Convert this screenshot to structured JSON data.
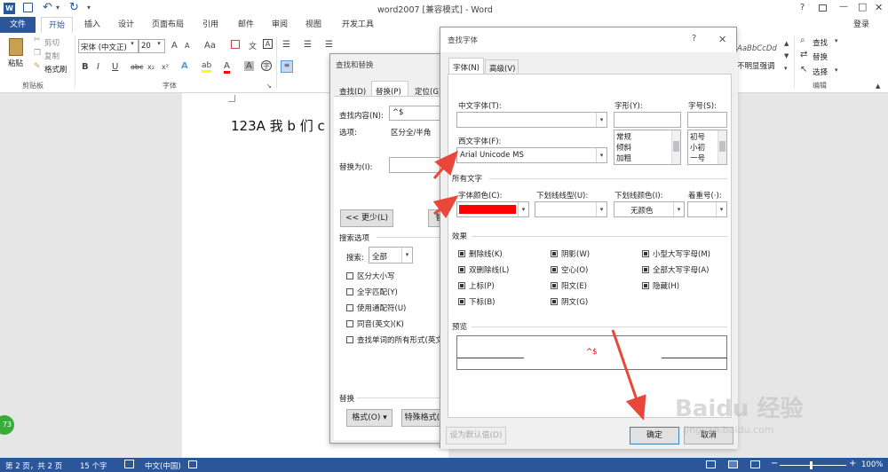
{
  "window": {
    "title": "word2007 [兼容模式] - Word",
    "help": "?",
    "minimize": "—",
    "restore": "□",
    "close": "✕",
    "login": "登录"
  },
  "qat": {
    "word": "W",
    "save": "💾",
    "undo": "↶",
    "redo": "↻",
    "more": "▾"
  },
  "tabs": [
    "文件",
    "开始",
    "插入",
    "设计",
    "页面布局",
    "引用",
    "邮件",
    "审阅",
    "视图",
    "开发工具"
  ],
  "ribbon": {
    "clipboard": {
      "paste": "粘贴",
      "cut": "剪切",
      "copy": "复制",
      "painter": "格式刷",
      "label": "剪贴板"
    },
    "font": {
      "name": "宋体 (中文正)",
      "size": "20",
      "label": "字体",
      "b": "B",
      "i": "I",
      "u": "U",
      "strike": "abc",
      "sub": "x₂",
      "sup": "x²",
      "grow": "A",
      "shrink": "A",
      "aa": "Aa",
      "a_color": "A"
    },
    "styles": {
      "sample": "AaBbCcDd",
      "name": "不明显强调"
    },
    "editing": {
      "find": "查找",
      "replace": "替换",
      "select": "选择",
      "label": "编辑"
    }
  },
  "doc": {
    "text": "123A 我 b 们 c"
  },
  "find_replace": {
    "title": "查找和替换",
    "tabs": [
      "查找(D)",
      "替换(P)",
      "定位(G)"
    ],
    "find_label": "查找内容(N):",
    "find_value": "^$",
    "options_label": "选项:",
    "options_value": "区分全/半角",
    "replace_label": "替换为(I):",
    "less_btn": "<< 更少(L)",
    "search_options": "搜索选项",
    "search_label": "搜索:",
    "search_value": "全部",
    "checks": [
      "区分大小写",
      "全字匹配(Y)",
      "使用通配符(U)",
      "同音(英文)(K)",
      "查找单词的所有形式(英文)"
    ],
    "replace_section": "替换",
    "format_btn": "格式(O) ▾",
    "special_btn": "特殊格式(E)"
  },
  "font_dialog": {
    "title": "查找字体",
    "help": "?",
    "close": "✕",
    "tabs": [
      "字体(N)",
      "高级(V)"
    ],
    "cn_font_label": "中文字体(T):",
    "style_label": "字形(Y):",
    "size_label": "字号(S):",
    "style_options": [
      "常规",
      "倾斜",
      "加粗"
    ],
    "size_options": [
      "初号",
      "小初",
      "一号"
    ],
    "west_font_label": "西文字体(F):",
    "west_font_value": "Arial Unicode MS",
    "all_text": "所有文字",
    "color_label": "字体颜色(C):",
    "underline_label": "下划线线型(U):",
    "ucolor_label": "下划线颜色(I):",
    "ucolor_value": "无颜色",
    "emph_label": "着重号(·):",
    "effects_label": "效果",
    "effects": [
      [
        "删除线(K)",
        "阴影(W)",
        "小型大写字母(M)"
      ],
      [
        "双删除线(L)",
        "空心(O)",
        "全部大写字母(A)"
      ],
      [
        "上标(P)",
        "阳文(E)",
        "隐藏(H)"
      ],
      [
        "下标(B)",
        "阴文(G)",
        ""
      ]
    ],
    "preview_label": "预览",
    "preview_text": "^$",
    "default_btn": "设为默认值(D)",
    "ok": "确定",
    "cancel": "取消"
  },
  "status": {
    "page": "第 2 页，共 2 页",
    "words": "15 个字",
    "lang": "中文(中国)",
    "zoom": "100%",
    "badge": "73"
  },
  "colors": {
    "accent": "#2b579a",
    "font_red": "#ff0000",
    "arrow": "#e8473a"
  },
  "watermark": "Baidu 经验",
  "watermark_url": "jingyan.baidu.com"
}
